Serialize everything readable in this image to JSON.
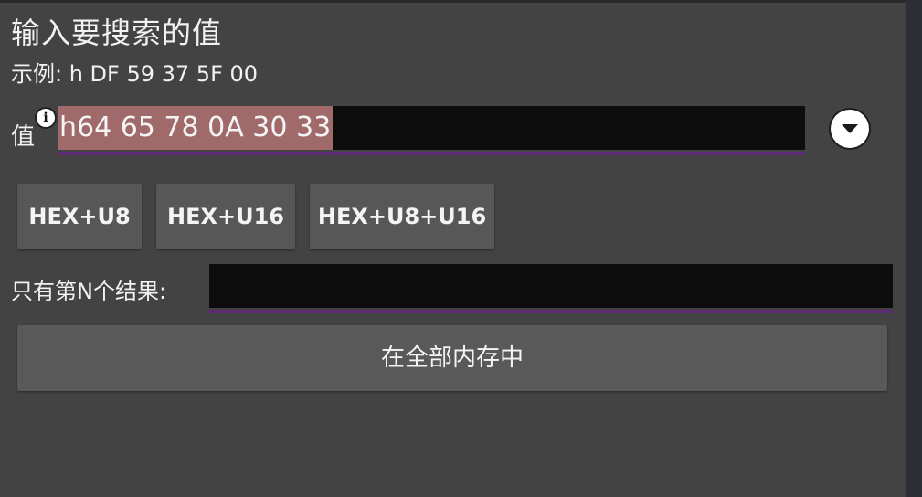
{
  "dialog": {
    "title": "输入要搜索的值",
    "example": "示例: h DF 59 37 5F 00"
  },
  "value_field": {
    "label": "值",
    "info_icon": "info-icon",
    "value": "h64 65 78 0A 30 33",
    "dropdown_icon": "chevron-down-icon"
  },
  "type_buttons": [
    {
      "label": "HEX+U8"
    },
    {
      "label": "HEX+U16"
    },
    {
      "label": "HEX+U8+U16"
    }
  ],
  "nth_result": {
    "label": "只有第N个结果:",
    "value": ""
  },
  "memory_button": {
    "label": "在全部内存中"
  },
  "colors": {
    "dialog_bg": "#434343",
    "input_bg": "#0d0d0d",
    "underline": "#5e2a73",
    "selection": "#a06a6a",
    "button_bg": "#575757"
  }
}
